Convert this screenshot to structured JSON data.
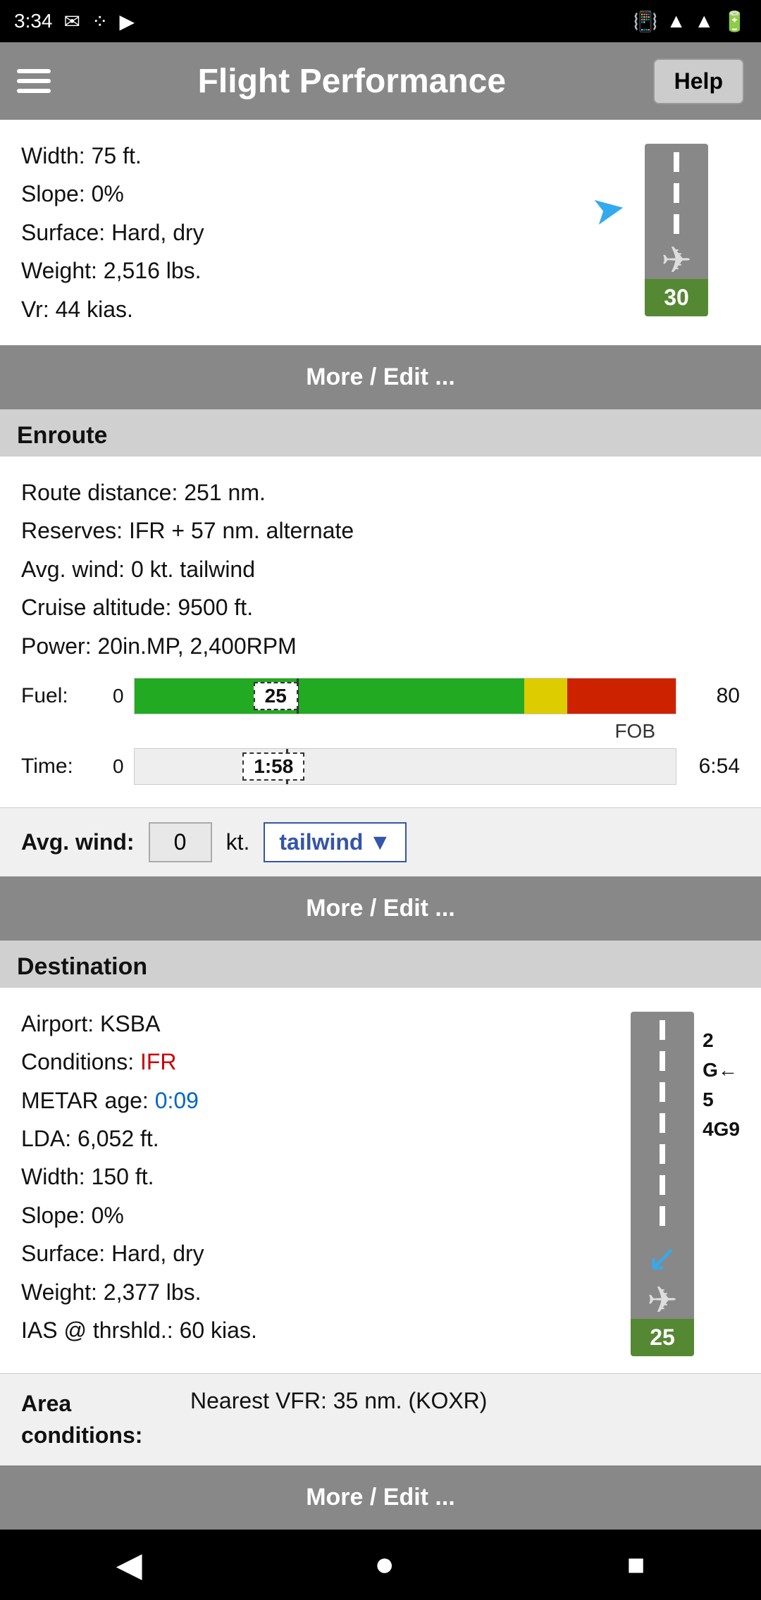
{
  "statusBar": {
    "time": "3:34",
    "icons": [
      "mail",
      "dots",
      "play"
    ]
  },
  "header": {
    "title": "Flight Performance",
    "helpLabel": "Help",
    "menuLabel": "menu"
  },
  "departure": {
    "width": "Width: 75 ft.",
    "slope": "Slope: 0%",
    "surface": "Surface: Hard, dry",
    "weight": "Weight: 2,516 lbs.",
    "vr": "Vr: 44 kias.",
    "runwayNumber": "30",
    "moreEditLabel": "More / Edit ..."
  },
  "enrouteLabel": "Enroute",
  "enroute": {
    "routeDistance": "Route distance: 251 nm.",
    "reserves": "Reserves: IFR + 57 nm. alternate",
    "avgWind": "Avg. wind: 0 kt. tailwind",
    "cruiseAltitude": "Cruise altitude: 9500 ft.",
    "power": "Power: 20in.MP, 2,400RPM",
    "fuelStart": "0",
    "fuelMarker": "25",
    "fuelEnd": "80",
    "fuelLabel": "Fuel:",
    "fobLabel": "FOB",
    "timeStart": "0",
    "timeMarker": "1:58",
    "timeEnd": "6:54",
    "timeLabel": "Time:",
    "avgWindLabel": "Avg. wind:",
    "windValue": "0",
    "windUnit": "kt.",
    "windDirection": "tailwind",
    "windDropdownArrow": "▼",
    "moreEditLabel": "More / Edit ..."
  },
  "destinationLabel": "Destination",
  "destination": {
    "airport": "Airport: KSBA",
    "conditions": "Conditions:",
    "conditionsValue": "IFR",
    "metarAge": "METAR age:",
    "metarAgeValue": "0:09",
    "lda": "LDA: 6,052 ft.",
    "width": "Width: 150 ft.",
    "slope": "Slope: 0%",
    "surface": "Surface: Hard, dry",
    "weight": "Weight: 2,377 lbs.",
    "ias": "IAS @ thrshld.: 60 kias.",
    "runwayNumber": "25",
    "runwaySideNumbers": [
      "2",
      "G←",
      "5",
      "4G9"
    ],
    "areaConditionsLabel": "Area conditions:",
    "nearestVfr": "Nearest VFR: 35 nm. (KOXR)",
    "moreEditLabel": "More / Edit ..."
  },
  "navbar": {
    "backLabel": "◀",
    "homeLabel": "●",
    "squareLabel": "■"
  }
}
